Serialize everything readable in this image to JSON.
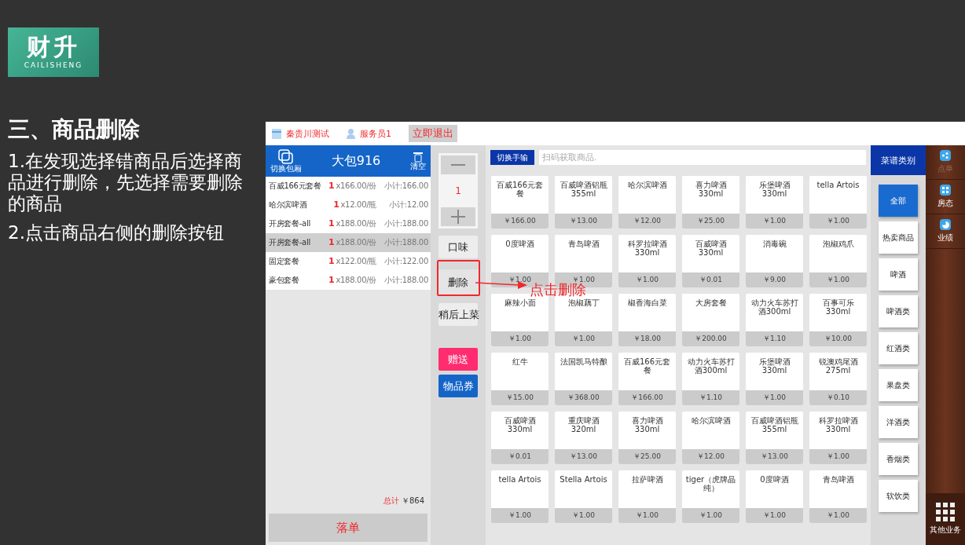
{
  "slide": {
    "logo": {
      "mark": "财升",
      "wordmark": "CAILISHENG"
    },
    "title": "三、商品删除",
    "steps": [
      "1.在发现选择错商品后选择商品进行删除，先选择需要删除的商品",
      "2.点击商品右侧的删除按钮"
    ],
    "callout": "点击删除"
  },
  "app": {
    "top_bar": {
      "store": "秦贵川测试",
      "waiter": "服务员1",
      "exit_button": "立即退出"
    },
    "order": {
      "switch_label": "切换包厢",
      "room": "大包916",
      "clear_label": "清空",
      "items": [
        {
          "name": "百威166元套餐",
          "qty": "1",
          "unit": "x166.00/份",
          "subtotal": "小计:166.00",
          "selected": false
        },
        {
          "name": "哈尔滨啤酒",
          "qty": "1",
          "unit": "x12.00/瓶",
          "subtotal": "小计:12.00",
          "selected": false
        },
        {
          "name": "开房套餐-all",
          "qty": "1",
          "unit": "x188.00/份",
          "subtotal": "小计:188.00",
          "selected": false
        },
        {
          "name": "开房套餐-all",
          "qty": "1",
          "unit": "x188.00/份",
          "subtotal": "小计:188.00",
          "selected": true
        },
        {
          "name": "固定套餐",
          "qty": "1",
          "unit": "x122.00/瓶",
          "subtotal": "小计:122.00",
          "selected": false
        },
        {
          "name": "豪包套餐",
          "qty": "1",
          "unit": "x188.00/份",
          "subtotal": "小计:188.00",
          "selected": false
        }
      ],
      "total_label": "总计",
      "total": "￥864",
      "submit_button": "落单"
    },
    "actions": {
      "quantity": "1",
      "buttons": [
        {
          "label": "口味",
          "kind": "plain",
          "highlighted": false
        },
        {
          "label": "删除",
          "kind": "plain",
          "highlighted": true
        },
        {
          "label": "稍后上菜",
          "kind": "plain",
          "highlighted": false
        },
        {
          "label": "赠送",
          "kind": "gift",
          "highlighted": false
        },
        {
          "label": "物品券",
          "kind": "voucher",
          "highlighted": false
        }
      ]
    },
    "toolbar": {
      "switch_button": "切换手输",
      "search": {
        "placeholder": "扫码获取商品."
      }
    },
    "products": [
      {
        "name": "百威166元套餐",
        "price": "￥166.00"
      },
      {
        "name": "百威啤酒铝瓶355ml",
        "price": "￥13.00"
      },
      {
        "name": "哈尔滨啤酒",
        "price": "￥12.00"
      },
      {
        "name": "喜力啤酒330ml",
        "price": "￥25.00"
      },
      {
        "name": "乐堡啤酒330ml",
        "price": "￥1.00"
      },
      {
        "name": "tella Artois",
        "price": "￥1.00"
      },
      {
        "name": "0度啤酒",
        "price": "￥1.00"
      },
      {
        "name": "青岛啤酒",
        "price": "￥1.00"
      },
      {
        "name": "科罗拉啤酒330ml",
        "price": "￥1.00"
      },
      {
        "name": "百威啤酒330ml",
        "price": "￥0.01"
      },
      {
        "name": "消毒碗",
        "price": "￥9.00"
      },
      {
        "name": "泡椒鸡爪",
        "price": "￥1.00"
      },
      {
        "name": "麻辣小面",
        "price": "￥1.00"
      },
      {
        "name": "泡椒藕丁",
        "price": "￥1.00"
      },
      {
        "name": "椒香海白菜",
        "price": "￥18.00"
      },
      {
        "name": "大房套餐",
        "price": "￥200.00"
      },
      {
        "name": "动力火车苏打酒300ml",
        "price": "￥1.10"
      },
      {
        "name": "百事可乐330ml",
        "price": "￥10.00"
      },
      {
        "name": "红牛",
        "price": "￥15.00"
      },
      {
        "name": "法国凯马特酿",
        "price": "￥368.00"
      },
      {
        "name": "百威166元套餐",
        "price": "￥166.00"
      },
      {
        "name": "动力火车苏打酒300ml",
        "price": "￥1.10"
      },
      {
        "name": "乐堡啤酒330ml",
        "price": "￥1.00"
      },
      {
        "name": "锐澳鸡尾酒275ml",
        "price": "￥0.10"
      },
      {
        "name": "百威啤酒330ml",
        "price": "￥0.01"
      },
      {
        "name": "重庆啤酒320ml",
        "price": "￥13.00"
      },
      {
        "name": "喜力啤酒330ml",
        "price": "￥25.00"
      },
      {
        "name": "哈尔滨啤酒",
        "price": "￥12.00"
      },
      {
        "name": "百威啤酒铝瓶355ml",
        "price": "￥13.00"
      },
      {
        "name": "科罗拉啤酒330ml",
        "price": "￥1.00"
      },
      {
        "name": "tella Artois",
        "price": "￥1.00"
      },
      {
        "name": "Stella Artois",
        "price": "￥1.00"
      },
      {
        "name": "拉萨啤酒",
        "price": "￥1.00"
      },
      {
        "name": "tiger（虎牌晶纯）",
        "price": "￥1.00"
      },
      {
        "name": "0度啤酒",
        "price": "￥1.00"
      },
      {
        "name": "青岛啤酒",
        "price": "￥1.00"
      }
    ],
    "categories": {
      "title": "菜谱类别",
      "items": [
        {
          "label": "全部",
          "selected": true
        },
        {
          "label": "热卖商品",
          "selected": false
        },
        {
          "label": "啤酒",
          "selected": false
        },
        {
          "label": "啤酒类",
          "selected": false
        },
        {
          "label": "红酒类",
          "selected": false
        },
        {
          "label": "果盘类",
          "selected": false
        },
        {
          "label": "洋酒类",
          "selected": false
        },
        {
          "label": "香烟类",
          "selected": false
        },
        {
          "label": "软饮类",
          "selected": false
        }
      ]
    },
    "sidebar": {
      "items": [
        {
          "label": "点单",
          "kind": "order",
          "selected": true
        },
        {
          "label": "房态",
          "kind": "rooms",
          "selected": false
        },
        {
          "label": "业绩",
          "kind": "stats",
          "selected": false
        }
      ],
      "more": "其他业务"
    }
  }
}
